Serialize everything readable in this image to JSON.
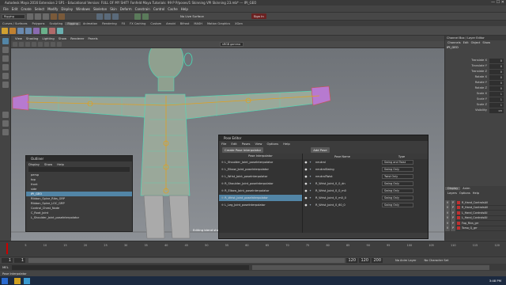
{
  "window": {
    "title": "Autodesk Maya 2016 Extension 2 SP1 - Educational Version: FULL OF MY SHIT! Fonfeld Maya Tutorials: 99 P P/poses/1 Skinning VPI Skinning 23.mb* --- IPI_GEO"
  },
  "menubar": [
    "File",
    "Edit",
    "Create",
    "Select",
    "Modify",
    "Display",
    "Windows",
    "Skeleton",
    "Skin",
    "Deform",
    "Constrain",
    "Control",
    "Cache",
    "Help"
  ],
  "statusline": {
    "mode": "Rigging",
    "live_surface": "No Live Surface",
    "sign_in": "Sign In"
  },
  "shelf_tabs": [
    "Curves / Surfaces",
    "Polygons",
    "Sculpting",
    "Rigging",
    "Animation",
    "Rendering",
    "FX",
    "FX Caching",
    "Custom",
    "Arnold",
    "Bifrost",
    "MASH",
    "Motion Graphics",
    "XGen"
  ],
  "shelf_active": "Rigging",
  "view_menu": [
    "View",
    "Shading",
    "Lighting",
    "Show",
    "Renderer",
    "Panels"
  ],
  "viewport": {
    "color_space": "sRGB gamma",
    "hud_text": "Editing blend shape"
  },
  "channel_box": {
    "header_tabs": [
      "Channel Box / Layer Editor"
    ],
    "menu": [
      "Channels",
      "Edit",
      "Object",
      "Show"
    ],
    "object": "IPI_GEO",
    "attributes": [
      {
        "name": "Translate X",
        "value": "0"
      },
      {
        "name": "Translate Y",
        "value": "0"
      },
      {
        "name": "Translate Z",
        "value": "0"
      },
      {
        "name": "Rotate X",
        "value": "0"
      },
      {
        "name": "Rotate Y",
        "value": "0"
      },
      {
        "name": "Rotate Z",
        "value": "0"
      },
      {
        "name": "Scale X",
        "value": "1"
      },
      {
        "name": "Scale Y",
        "value": "1"
      },
      {
        "name": "Scale Z",
        "value": "1"
      },
      {
        "name": "Visibility",
        "value": "on"
      }
    ]
  },
  "layer_editor": {
    "tabs": [
      "Display",
      "Anim"
    ],
    "menu": [
      "Layers",
      "Options",
      "Help"
    ],
    "layers": [
      "R_Hand_ControlsAll",
      "R_Hand_ControlsAll",
      "L_Hand_ControlsAll",
      "L_Hand_ControlsAll",
      "Fop_Rivs_grr",
      "Torso_Q_grr"
    ]
  },
  "outliner": {
    "title": "Outliner",
    "menu": [
      "Display",
      "Show",
      "Help"
    ],
    "items": [
      "persp",
      "top",
      "front",
      "side",
      "IPI_GEO",
      "Ribbon_Spine_Ribs_GRP",
      "Ribbon_Spine_LOC_GRP",
      "Control_Chest_Node",
      "C_Root_Joint",
      "L_Shoulder_Joint_poseInterpolator"
    ],
    "selected_index": 4
  },
  "pose_editor": {
    "title": "Pose Editor",
    "menu": [
      "File",
      "Edit",
      "Poses",
      "View",
      "Options",
      "Help"
    ],
    "create_button": "Create Pose Interpolator",
    "add_pose_button": "Add Pose",
    "left_header": "Pose Interpolator",
    "interpolators": [
      "L_Shoulder_Joint_poseInterpolator",
      "L_Elbow_Joint_poseInterpolator",
      "L_Wrist_Joint_poseInterpolator",
      "R_Shoulder_Joint_poseInterpolator",
      "R_Elbow_Joint_poseInterpolator",
      "R_Wrist_Joint_poseInterpolator",
      "L_Leg_Joint_poseInterpolator"
    ],
    "selected_interpolator": 5,
    "pose_headers": [
      "Pose Name",
      "Type"
    ],
    "poses": [
      {
        "name": "neutral",
        "type": "Swing and Twist"
      },
      {
        "name": "neutralSwing",
        "type": "Swing Only"
      },
      {
        "name": "neutralTwist",
        "type": "Twist Only"
      },
      {
        "name": "R_Wrist_Joint_0_0_dn",
        "type": "Swing Only"
      },
      {
        "name": "R_Wrist_Joint_0_0_m0",
        "type": "Swing Only"
      },
      {
        "name": "R_Wrist_Joint_0_m0_0",
        "type": "Swing Only"
      },
      {
        "name": "R_Wrist_Joint_0_60_0",
        "type": "Swing Only"
      }
    ]
  },
  "time_slider": {
    "ticks": [
      "1",
      "5",
      "10",
      "15",
      "20",
      "25",
      "30",
      "35",
      "40",
      "45",
      "50",
      "55",
      "60",
      "65",
      "70",
      "75",
      "80",
      "85",
      "90",
      "95",
      "100",
      "105",
      "110",
      "115",
      "120"
    ],
    "current_frame": "1"
  },
  "range_slider": {
    "start": "1",
    "start2": "1",
    "end": "120",
    "end2": "120",
    "end3": "200",
    "anim_layer": "No Anim Layer",
    "char_set": "No Character Set"
  },
  "cmdline": {
    "label": "MEL"
  },
  "helpline": {
    "text": "Pose Interpolator"
  },
  "taskbar": {
    "time": "3:48 PM"
  },
  "colors": {
    "selection": "#5285a6",
    "wire": "#47e0b8",
    "joint": "#e0a020"
  }
}
